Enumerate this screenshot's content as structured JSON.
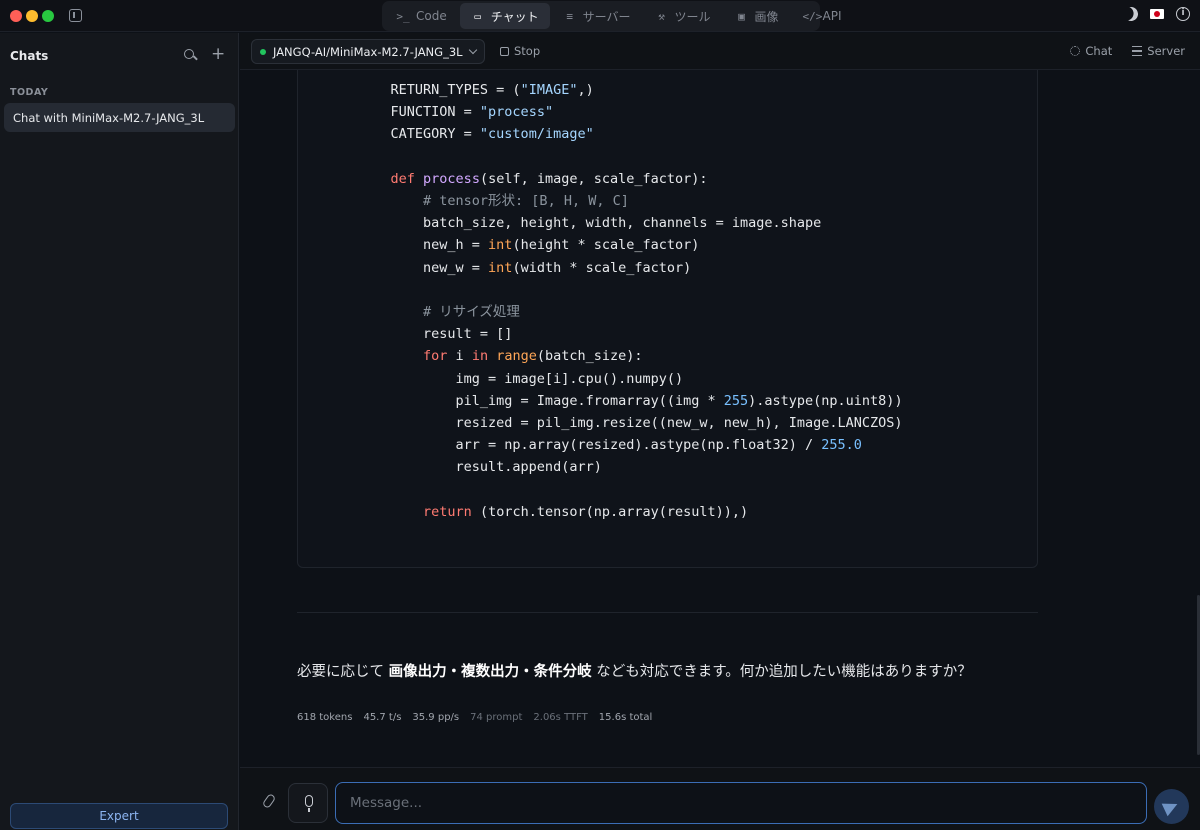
{
  "titlebar": {
    "tabs": [
      {
        "icon": ">_",
        "label": "Code",
        "active": false
      },
      {
        "icon": "▭",
        "label": "チャット",
        "active": true
      },
      {
        "icon": "≡",
        "label": "サーバー",
        "active": false
      },
      {
        "icon": "⚒",
        "label": "ツール",
        "active": false
      },
      {
        "icon": "▣",
        "label": "画像",
        "active": false
      },
      {
        "icon": "</>",
        "label": "API",
        "active": false
      }
    ]
  },
  "sidebar": {
    "title": "Chats",
    "section": "TODAY",
    "chats": [
      "Chat with MiniMax-M2.7-JANG_3L"
    ],
    "expert_label": "Expert"
  },
  "mainbar": {
    "model": "JANGQ-AI/MiniMax-M2.7-JANG_3L",
    "stop_label": "Stop",
    "chat_label": "Chat",
    "server_label": "Server"
  },
  "code_lines": [
    "    RETURN_TYPES = (\"IMAGE\",)",
    "    FUNCTION = \"process\"",
    "    CATEGORY = \"custom/image\"",
    "",
    "    def process(self, image, scale_factor):",
    "        # tensor形状: [B, H, W, C]",
    "        batch_size, height, width, channels = image.shape",
    "        new_h = int(height * scale_factor)",
    "        new_w = int(width * scale_factor)",
    "",
    "        # リサイズ処理",
    "        result = []",
    "        for i in range(batch_size):",
    "            img = image[i].cpu().numpy()",
    "            pil_img = Image.fromarray((img * 255).astype(np.uint8))",
    "            resized = pil_img.resize((new_w, new_h), Image.LANCZOS)",
    "            arr = np.array(resized).astype(np.float32) / 255.0",
    "            result.append(arr)",
    "",
    "        return (torch.tensor(np.array(result)),)"
  ],
  "answer": {
    "prefix": "必要に応じて ",
    "bold": "画像出力・複数出力・条件分岐",
    "suffix": " なども対応できます。何か追加したい機能はありますか？"
  },
  "stats": {
    "tokens": "618 tokens",
    "tps": "45.7 t/s",
    "pps": "35.9 pp/s",
    "prompt": "74 prompt",
    "ttft": "2.06s TTFT",
    "total": "15.6s total"
  },
  "composer": {
    "placeholder": "Message..."
  }
}
